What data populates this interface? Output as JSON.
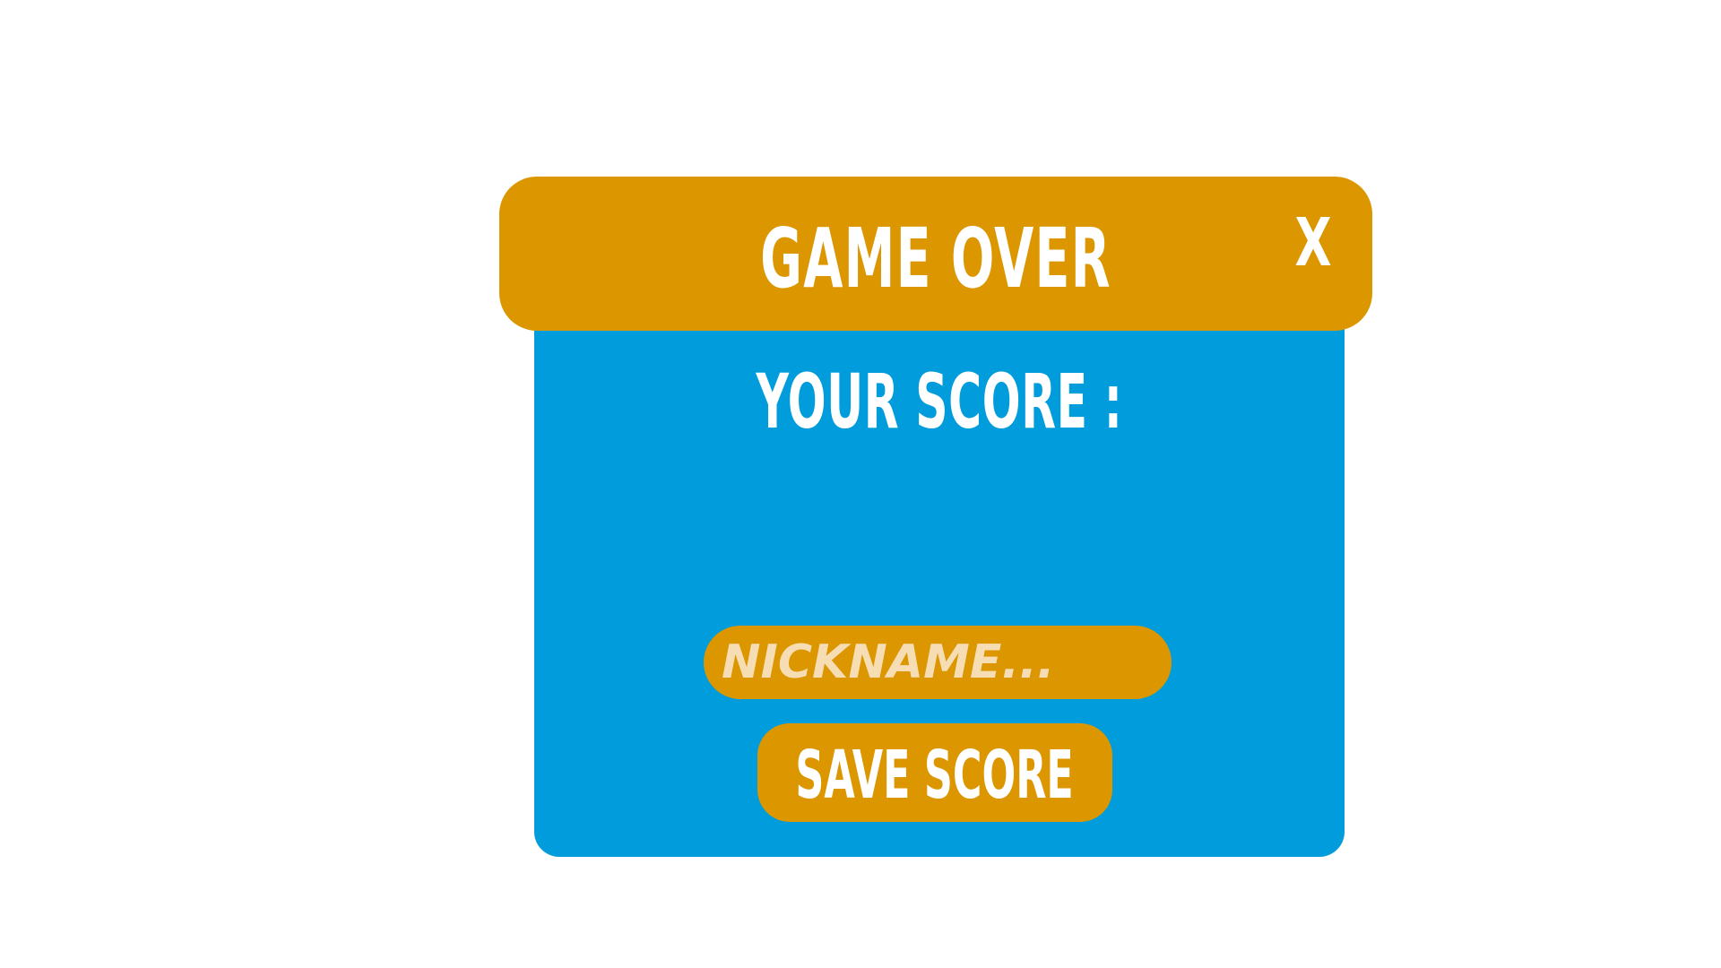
{
  "game_over_dialog": {
    "title": "GAME OVER",
    "close_label": "X",
    "score_label": "YOUR SCORE :",
    "nickname_placeholder": "NICKNAME...",
    "save_button_label": "SAVE SCORE"
  },
  "colors": {
    "panel_background": "#009cdb",
    "header_background": "#db9600",
    "button_background": "#db9600",
    "text": "#ffffff",
    "placeholder_text": "#f6ddb4"
  }
}
